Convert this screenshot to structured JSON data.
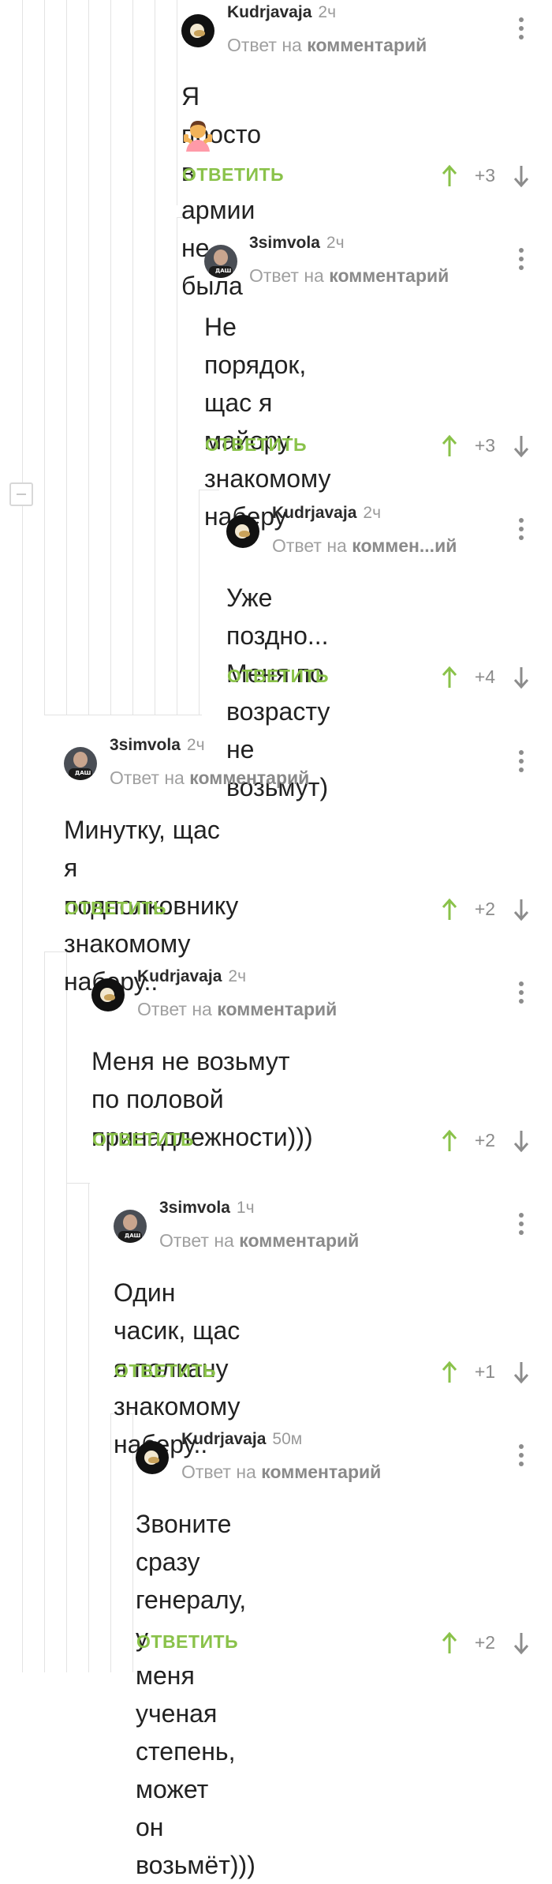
{
  "reply_label": "ОТВЕТИТЬ",
  "reply_prefix": "Ответ на",
  "reply_target": "комментарий",
  "comments": [
    {
      "author": "Kudrjavaja",
      "time": "2ч",
      "reply_target": "комментарий",
      "lines": [
        "Я просто в армии не была"
      ],
      "emoji": "person-shrugging",
      "score": "+3"
    },
    {
      "author": "3simvola",
      "time": "2ч",
      "reply_target": "комментарий",
      "lines": [
        "Не порядок, щас я",
        "майору знакомому",
        "наберу"
      ],
      "score": "+3"
    },
    {
      "author": "Kudrjavaja",
      "time": "2ч",
      "reply_target": "коммен...ий",
      "lines": [
        "Уже поздно... Меня по",
        "возрасту не возьмут)"
      ],
      "score": "+4"
    },
    {
      "author": "3simvola",
      "time": "2ч",
      "reply_target": "комментарий",
      "lines": [
        "Минутку, щас я подполковнику",
        "знакомому наберу.."
      ],
      "score": "+2"
    },
    {
      "author": "Kudrjavaja",
      "time": "2ч",
      "reply_target": "комментарий",
      "lines": [
        "Меня не возьмут по половой",
        "принадлежности)))"
      ],
      "score": "+2"
    },
    {
      "author": "3simvola",
      "time": "1ч",
      "reply_target": "комментарий",
      "lines": [
        "Один часик, щас я полкану",
        "знакомому наберу.."
      ],
      "score": "+1"
    },
    {
      "author": "Kudrjavaja",
      "time": "50м",
      "reply_target": "комментарий",
      "lines": [
        "Звоните сразу генералу, у",
        "меня ученая степень, может",
        "он возьмёт)))"
      ],
      "score": "+2"
    }
  ],
  "avatar_badge": "ДАШ",
  "colors": {
    "accent_green": "#8ac24a",
    "muted": "#9a9a9a",
    "thread_line": "#e3e3e3"
  },
  "icons": [
    "avatar",
    "more-vertical-icon",
    "arrow-up-icon",
    "arrow-down-icon",
    "collapse-thread-icon",
    "person-shrugging-emoji"
  ]
}
